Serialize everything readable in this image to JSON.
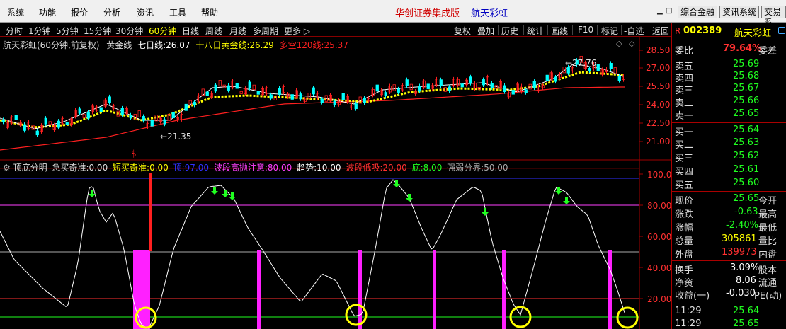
{
  "menubar": {
    "items": [
      "系统",
      "功能",
      "报价",
      "分析",
      "资讯",
      "工具",
      "帮助"
    ],
    "brand": "华创证券集成版",
    "stock_title": "航天彩虹",
    "right_buttons": [
      "综合金融",
      "资讯系统",
      "交易系"
    ]
  },
  "toolbar": {
    "periods": [
      "分时",
      "1分钟",
      "5分钟",
      "15分钟",
      "30分钟",
      "60分钟",
      "日线",
      "周线",
      "月线",
      "多周期",
      "更多 ▷"
    ],
    "active_period": "60分钟",
    "tools": [
      "复权",
      "叠加",
      "历史",
      "统计",
      "画线",
      "F10",
      "标记",
      "-自选",
      "返回"
    ]
  },
  "price_panel": {
    "title": "航天彩虹(60分钟,前复权)",
    "indicator_name": "黄金线",
    "ma7": {
      "label": "七日线:",
      "value": "26.07",
      "color": "#ffffff"
    },
    "ma18": {
      "label": "十八日黄金线:",
      "value": "26.29",
      "color": "#ffff00"
    },
    "ma120": {
      "label": "多空120线:",
      "value": "25.37",
      "color": "#ff2020"
    },
    "low_label": "←21.35",
    "high_label": "←27.76",
    "axis_labels": [
      "28.50",
      "27.00",
      "25.50",
      "24.00",
      "22.50",
      "21.00"
    ],
    "arrow_icons": [
      "◇",
      "◇"
    ]
  },
  "osc_panel": {
    "title": "顶底分明",
    "items": [
      {
        "label": "急买奇准:",
        "value": "0.00",
        "color": "#dddddd"
      },
      {
        "label": "短买奇准:",
        "value": "0.00",
        "color": "#ffff00"
      },
      {
        "label": "顶:",
        "value": "97.00",
        "color": "#3030ff"
      },
      {
        "label": "波段高抛注意:",
        "value": "80.00",
        "color": "#ff40ff"
      },
      {
        "label": "趋势:",
        "value": "10.00",
        "color": "#ffffff"
      },
      {
        "label": "波段低吸:",
        "value": "20.00",
        "color": "#ff3030"
      },
      {
        "label": "底:",
        "value": "8.00",
        "color": "#20ff20"
      },
      {
        "label": "强弱分界:",
        "value": "50.00",
        "color": "#aaaaaa"
      }
    ],
    "axis_labels": [
      "100.0",
      "80.00",
      "60.00",
      "40.00",
      "20.00"
    ],
    "dollar_icon": "$"
  },
  "quote": {
    "code": "002389",
    "name": "航天彩虹",
    "webi": {
      "label": "委比",
      "value": "79.64%",
      "extra": "委差"
    },
    "asks": [
      {
        "label": "卖五",
        "price": "25.69"
      },
      {
        "label": "卖四",
        "price": "25.68"
      },
      {
        "label": "卖三",
        "price": "25.67"
      },
      {
        "label": "卖二",
        "price": "25.66"
      },
      {
        "label": "卖一",
        "price": "25.65"
      }
    ],
    "bids": [
      {
        "label": "买一",
        "price": "25.64"
      },
      {
        "label": "买二",
        "price": "25.63"
      },
      {
        "label": "买三",
        "price": "25.62"
      },
      {
        "label": "买四",
        "price": "25.61"
      },
      {
        "label": "买五",
        "price": "25.60"
      }
    ],
    "stats": [
      {
        "label": "现价",
        "value": "25.65",
        "color": "#20ff20",
        "extra": "今开"
      },
      {
        "label": "涨跌",
        "value": "-0.63",
        "color": "#20ff20",
        "extra": "最高"
      },
      {
        "label": "涨幅",
        "value": "-2.40%",
        "color": "#20ff20",
        "extra": "最低"
      },
      {
        "label": "总量",
        "value": "305861",
        "color": "#ffff00",
        "extra": "量比"
      },
      {
        "label": "外盘",
        "value": "139973",
        "color": "#ff3030",
        "extra": "内盘"
      }
    ],
    "stats2": [
      {
        "label": "换手",
        "value": "3.09%",
        "extra": "股本"
      },
      {
        "label": "净资",
        "value": "8.06",
        "extra": "流通"
      },
      {
        "label": "收益(一)",
        "value": "-0.030",
        "extra": "PE(动)"
      }
    ],
    "ticks": [
      {
        "time": "11:29",
        "price": "25.64"
      },
      {
        "time": "11:29",
        "price": "25.65"
      }
    ]
  }
}
